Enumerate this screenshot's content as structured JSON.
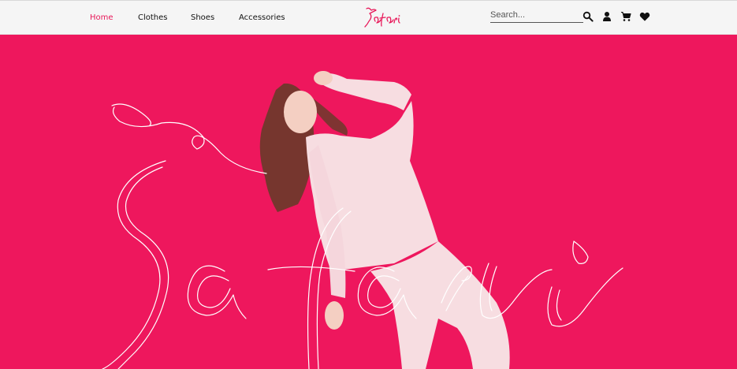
{
  "nav": {
    "links": [
      {
        "label": "Home",
        "active": true
      },
      {
        "label": "Clothes",
        "active": false
      },
      {
        "label": "Shoes",
        "active": false
      },
      {
        "label": "Accessories",
        "active": false
      }
    ]
  },
  "brand": {
    "logo_text": "Safari",
    "accent_color": "#e8195a",
    "hero_background": "#ee175d"
  },
  "search": {
    "placeholder": "Search...",
    "value": ""
  },
  "icons": {
    "search": "search-icon",
    "account": "user-icon",
    "cart": "cart-icon",
    "wishlist": "heart-icon"
  }
}
